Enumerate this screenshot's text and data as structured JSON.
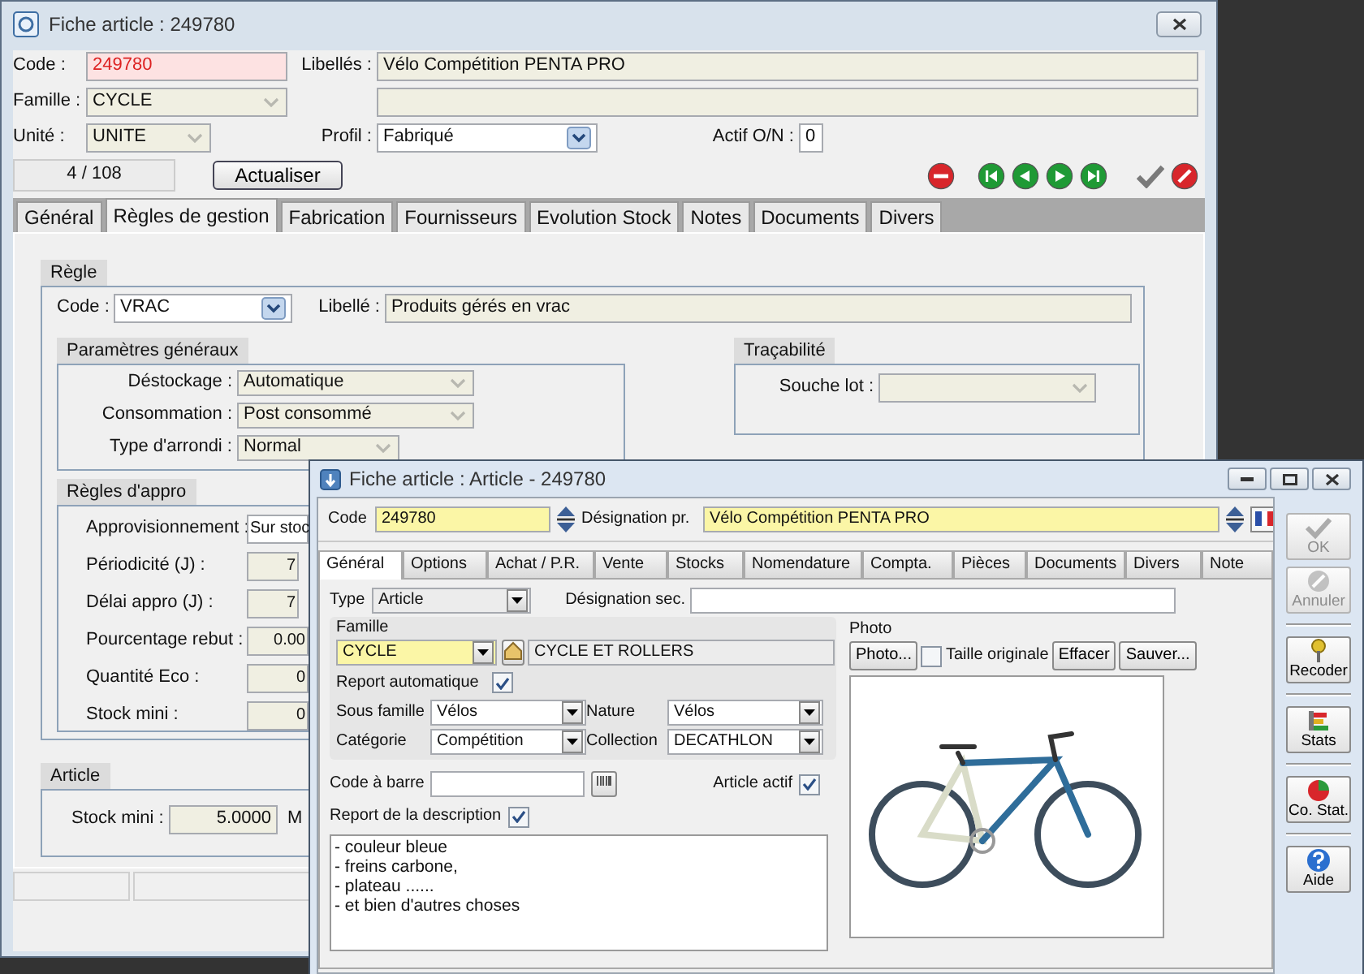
{
  "back_window": {
    "title": "Fiche article : 249780",
    "code": {
      "label": "Code :",
      "value": "249780"
    },
    "libelles": {
      "label": "Libellés :",
      "value": "Vélo Compétition PENTA PRO"
    },
    "famille": {
      "label": "Famille :",
      "value": "CYCLE"
    },
    "unite": {
      "label": "Unité :",
      "value": "UNITE"
    },
    "profil": {
      "label": "Profil :",
      "value": "Fabriqué"
    },
    "actif": {
      "label": "Actif O/N :",
      "value": "0"
    },
    "record_counter": "4 / 108",
    "refresh_button": "Actualiser",
    "tabs": [
      {
        "label": "Général",
        "selected": false
      },
      {
        "label": "Règles de gestion",
        "selected": true
      },
      {
        "label": "Fabrication",
        "selected": false
      },
      {
        "label": "Fournisseurs",
        "selected": false
      },
      {
        "label": "Evolution Stock",
        "selected": false
      },
      {
        "label": "Notes",
        "selected": false
      },
      {
        "label": "Documents",
        "selected": false
      },
      {
        "label": "Divers",
        "selected": false
      }
    ],
    "regle": {
      "title": "Règle",
      "code": {
        "label": "Code :",
        "value": "VRAC"
      },
      "libelle": {
        "label": "Libellé :",
        "value": "Produits gérés en vrac"
      }
    },
    "parametres_generaux": {
      "title": "Paramètres généraux",
      "rows": [
        {
          "label": "Déstockage :",
          "value": "Automatique"
        },
        {
          "label": "Consommation :",
          "value": "Post consommé"
        },
        {
          "label": "Type d'arrondi :",
          "value": "Normal"
        }
      ]
    },
    "tracabilite": {
      "title": "Traçabilité",
      "rows": [
        {
          "label": "Souche lot :"
        }
      ]
    },
    "regles_appro": {
      "title": "Règles d'appro",
      "rows": [
        {
          "label": "Approvisionnement :",
          "value": "Sur stoc",
          "kind": "text"
        },
        {
          "label": "Périodicité (J) :",
          "value": "7",
          "kind": "short"
        },
        {
          "label": "Délai appro (J) :",
          "value": "7",
          "kind": "short"
        },
        {
          "label": "Pourcentage rebut :",
          "value": "0.00",
          "kind": "number"
        },
        {
          "label": "Quantité Eco :",
          "value": "0",
          "kind": "number"
        },
        {
          "label": "Stock mini :",
          "value": "0",
          "kind": "number"
        }
      ]
    },
    "article": {
      "title": "Article",
      "rows": [
        {
          "label": "Stock mini :",
          "value": "5.0000"
        }
      ],
      "column_2_label": "M"
    }
  },
  "front_window": {
    "title": "Fiche article : Article - 249780",
    "code": {
      "label": "Code",
      "value": "249780"
    },
    "designation": {
      "label": "Désignation pr.",
      "value": "Vélo Compétition PENTA PRO"
    },
    "tabs": [
      {
        "label": "Général",
        "selected": true
      },
      {
        "label": "Options",
        "selected": false
      },
      {
        "label": "Achat / P.R.",
        "selected": false
      },
      {
        "label": "Vente",
        "selected": false
      },
      {
        "label": "Stocks",
        "selected": false
      },
      {
        "label": "Nomendature",
        "selected": false
      },
      {
        "label": "Compta.",
        "selected": false
      },
      {
        "label": "Pièces",
        "selected": false
      },
      {
        "label": "Documents",
        "selected": false
      },
      {
        "label": "Divers",
        "selected": false
      },
      {
        "label": "Note",
        "selected": false
      }
    ],
    "type": {
      "label": "Type",
      "value": "Article"
    },
    "designation_sec": {
      "label": "Désignation sec."
    },
    "famille_group": {
      "title": "Famille",
      "code": "CYCLE",
      "name": "CYCLE ET ROLLERS",
      "report_automatique": {
        "label": "Report automatique",
        "checked": true
      },
      "sous_famille": {
        "label": "Sous famille",
        "value": "Vélos"
      },
      "nature": {
        "label": "Nature",
        "value": "Vélos"
      },
      "categorie": {
        "label": "Catégorie",
        "value": "Compétition"
      },
      "collection": {
        "label": "Collection",
        "value": "DECATHLON"
      }
    },
    "code_barre": {
      "label": "Code à barre"
    },
    "article_actif": {
      "label": "Article actif",
      "checked": true
    },
    "report_description": {
      "label": "Report de la description",
      "checked": true
    },
    "description": [
      "- couleur bleue",
      "- freins carbone,",
      "- plateau ......",
      "- et bien d'autres choses"
    ],
    "photo": {
      "title": "Photo",
      "photo_button": "Photo...",
      "taille_originale": {
        "label": "Taille originale",
        "checked": false
      },
      "clear_button": "Effacer",
      "save_button": "Sauver..."
    },
    "side_buttons": [
      {
        "label": "OK",
        "disabled": true
      },
      {
        "label": "Annuler",
        "disabled": true
      },
      {
        "label": "Recoder",
        "disabled": false
      },
      {
        "label": "Stats",
        "disabled": false
      },
      {
        "label": "Co. Stat.",
        "disabled": false
      },
      {
        "label": "Aide",
        "disabled": false
      }
    ]
  }
}
